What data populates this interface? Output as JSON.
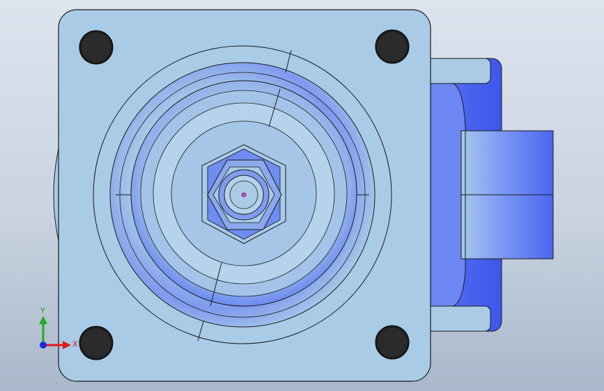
{
  "triad": {
    "x_label": "X",
    "y_label": "Y"
  },
  "colors": {
    "plate_fill": "#a9cbe6",
    "plate_stroke": "#1a1a1a",
    "blue_accent": "#4a66f0",
    "background_top": "#dde4ee",
    "background_bottom": "#aab8cb",
    "axis_x": "#e01818",
    "axis_y": "#22aa22",
    "axis_z": "#1a2bd8"
  },
  "icons": {
    "triad": "xyz-triad-icon"
  }
}
